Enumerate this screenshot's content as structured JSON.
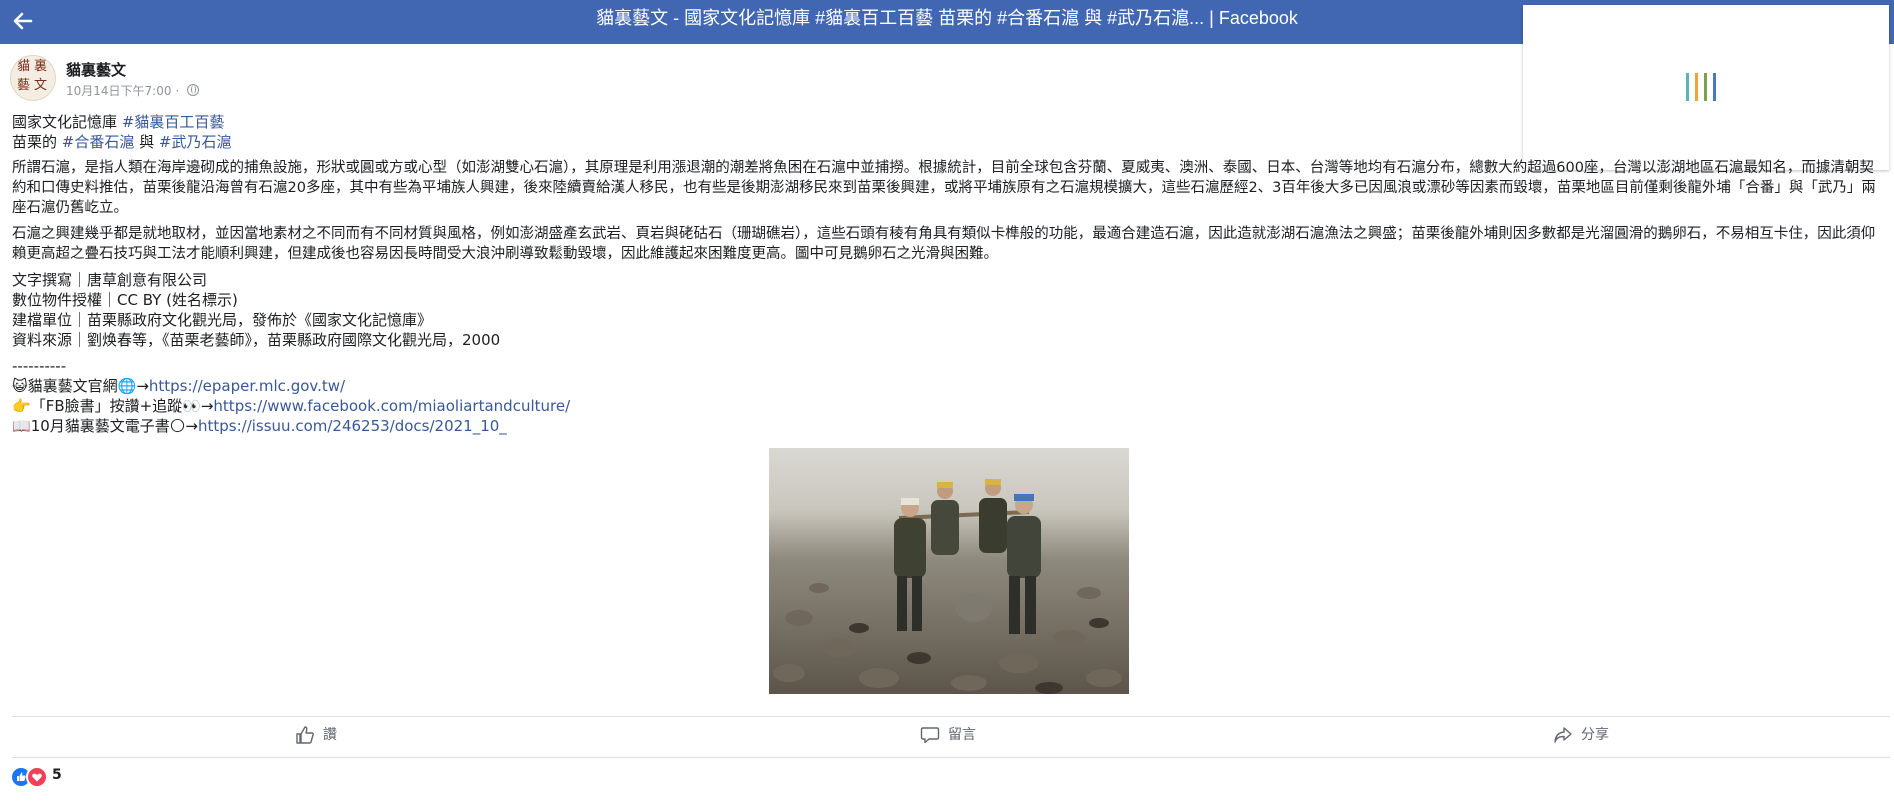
{
  "window": {
    "title": "貓裏藝文 - 國家文化記憶庫 #貓裏百工百藝 苗栗的 #合番石滬 與 #武乃石滬... | Facebook",
    "back_icon": "arrow-left-icon"
  },
  "colors": {
    "header_bg": "#4267b2",
    "link": "#385898",
    "loading_bars": [
      "#5fb3b3",
      "#f1a33c",
      "#7ea04d",
      "#4a78bd"
    ]
  },
  "post": {
    "page_name": "貓裏藝文",
    "avatar_text": "貓裏藝文",
    "timestamp": "10月14日下午7:00",
    "separator": " · ",
    "privacy_icon": "globe-icon",
    "line1": {
      "prefix": "國家文化記憶庫 ",
      "hashtag": "#貓裏百工百藝"
    },
    "line2": {
      "prefix": "苗栗的 ",
      "hashtag1": "#合番石滬",
      "middle": " 與 ",
      "hashtag2": "#武乃石滬"
    },
    "para1": "所謂石滬，是指人類在海岸邊砌成的捕魚設施，形狀或圓或方或心型（如澎湖雙心石滬），其原理是利用漲退潮的潮差將魚困在石滬中並捕撈。根據統計，目前全球包含芬蘭、夏威夷、澳洲、泰國、日本、台灣等地均有石滬分布，總數大約超過600座，台灣以澎湖地區石滬最知名，而據清朝契約和口傳史料推估，苗栗後龍沿海曾有石滬20多座，其中有些為平埔族人興建，後來陸續賣給漢人移民，也有些是後期澎湖移民來到苗栗後興建，或將平埔族原有之石滬規模擴大，這些石滬歷經2、3百年後大多已因風浪或漂砂等因素而毀壞，苗栗地區目前僅剩後龍外埔「合番」與「武乃」兩座石滬仍舊屹立。",
    "para2": "石滬之興建幾乎都是就地取材，並因當地素材之不同而有不同材質與風格，例如澎湖盛產玄武岩、頁岩與硓𥑮石（珊瑚礁岩），這些石頭有稜有角具有類似卡榫般的功能，最適合建造石滬，因此造就澎湖石滬漁法之興盛；苗栗後龍外埔則因多數都是光溜圓滑的鵝卵石，不易相互卡住，因此須仰賴更高超之疊石技巧與工法才能順利興建，但建成後也容易因長時間受大浪沖刷導致鬆動毀壞，因此維護起來困難度更高。圖中可見鵝卵石之光滑與困難。",
    "credits": [
      "文字撰寫｜唐草創意有限公司",
      "數位物件授權｜CC BY (姓名標示)",
      "建檔單位｜苗栗縣政府文化觀光局，發佈於《國家文化記憶庫》",
      "資料來源｜劉焕春等，《苗栗老藝師》，苗栗縣政府國際文化觀光局，2000"
    ],
    "separator_line": "----------",
    "links": [
      {
        "emoji": "😺",
        "text": "貓裏藝文官網🌐→",
        "url": "https://epaper.mlc.gov.tw/"
      },
      {
        "emoji": "👉",
        "text": "「FB臉書」按讚+追蹤👀→",
        "url": "https://www.facebook.com/miaoliartandculture/"
      },
      {
        "emoji": "📖",
        "text": "10月貓裏藝文電子書🌕→",
        "url": "https://issuu.com/246253/docs/2021_10_"
      }
    ],
    "photo_alt": "men-carrying-stone-on-pebble-beach"
  },
  "actions": {
    "like": "讚",
    "comment": "留言",
    "share": "分享"
  },
  "reactions": {
    "icons": [
      "like-reaction-icon",
      "love-reaction-icon"
    ],
    "count": "5"
  }
}
